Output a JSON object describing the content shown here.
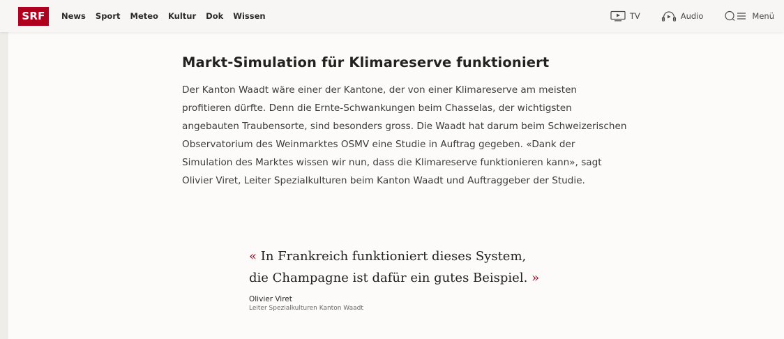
{
  "header": {
    "logo": "SRF",
    "nav": [
      "News",
      "Sport",
      "Meteo",
      "Kultur",
      "Dok",
      "Wissen"
    ],
    "right": {
      "tv": "TV",
      "audio": "Audio",
      "menu": "Menü"
    }
  },
  "article": {
    "headline": "Markt-Simulation für Klimareserve funktioniert",
    "body": "Der Kanton Waadt wäre einer der Kantone, der von einer Klimareserve am meisten profitieren dürfte. Denn die Ernte-Schwankungen beim Chasselas, der wichtigsten angebauten Traubensorte, sind besonders gross. Die Waadt hat darum beim Schweizerischen Observatorium des Weinmarktes OSMV eine Studie in Auftrag gegeben. «Dank der Simulation des Marktes wissen wir nun, dass die Klimareserve funktionieren kann», sagt Olivier Viret, Leiter Spezialkulturen beim Kanton Waadt und Auftraggeber der Studie."
  },
  "quote": {
    "open": "«",
    "text": "In Frankreich funktioniert dieses System, die Champagne ist dafür ein gutes Beispiel.",
    "close": "»",
    "author": "Olivier Viret",
    "role": "Leiter Spezialkulturen Kanton Waadt"
  },
  "colors": {
    "brand": "#af001e",
    "background": "#efedea",
    "card": "#fcfbfa"
  }
}
